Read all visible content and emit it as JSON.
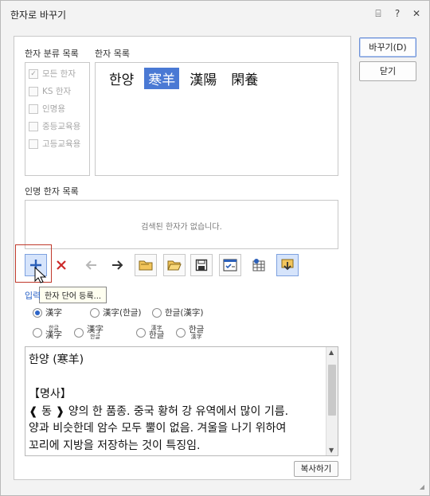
{
  "window": {
    "title": "한자로 바꾸기",
    "icons": [
      "message-icon",
      "help-icon",
      "close-icon"
    ],
    "icon_glyphs": [
      "⌸",
      "?",
      "✕"
    ]
  },
  "buttons": {
    "convert": "바꾸기(D)",
    "close": "닫기",
    "copy": "복사하기"
  },
  "category": {
    "label": "한자 분류 목록",
    "items": [
      {
        "label": "모든 한자",
        "checked": true
      },
      {
        "label": "KS 한자",
        "checked": false
      },
      {
        "label": "인명용",
        "checked": false
      },
      {
        "label": "중등교육용",
        "checked": false
      },
      {
        "label": "고등교육용",
        "checked": false
      }
    ]
  },
  "hanja_list": {
    "label": "한자 목록",
    "items": [
      "한양",
      "寒羊",
      "漢陽",
      "閑養"
    ],
    "selected_index": 1
  },
  "name_hanja": {
    "label": "인명 한자 목록",
    "empty_message": "검색된 한자가 없습니다."
  },
  "toolbar": {
    "tooltip": "한자 단어 등록..."
  },
  "input_format": {
    "label": "입력",
    "row1": [
      {
        "label": "漢字",
        "selected": true
      },
      {
        "label": "漢字(한글)",
        "selected": false
      },
      {
        "label": "한글(漢字)",
        "selected": false
      }
    ],
    "row2": [
      {
        "small": "한글",
        "big": "漢字"
      },
      {
        "small": "",
        "big": "漢字",
        "sub": "한글"
      },
      {
        "small": "漢字",
        "big": "한글"
      },
      {
        "small": "",
        "big": "한글",
        "sub": "漢字"
      }
    ]
  },
  "definition": {
    "lines": [
      "한양 (寒羊)",
      "",
      "【명사】",
      "❰ 동 ❱ 양의 한 품종. 중국 황허 강 유역에서 많이 기름.",
      "양과 비슷한데 암수 모두 뿔이 없음. 겨울을 나기 위하여",
      "꼬리에 지방을 저장하는 것이 특징임."
    ]
  }
}
